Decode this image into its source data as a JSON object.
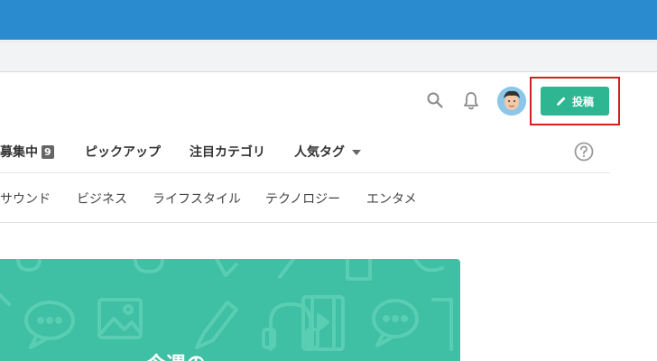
{
  "header": {
    "post_button_label": "投稿"
  },
  "nav": {
    "items": [
      {
        "label": "募集中",
        "badge": "9"
      },
      {
        "label": "ピックアップ"
      },
      {
        "label": "注目カテゴリ"
      },
      {
        "label": "人気タグ"
      }
    ]
  },
  "subnav": {
    "items": [
      "サウンド",
      "ビジネス",
      "ライフスタイル",
      "テクノロジー",
      "エンタメ"
    ]
  },
  "banner": {
    "title": "今週の"
  },
  "colors": {
    "top_band": "#2a8bcf",
    "post_button": "#2eb591",
    "highlight": "#d21f1f",
    "banner": "#3fbfa3"
  },
  "icons": [
    "search-icon",
    "bell-icon",
    "avatar",
    "pencil-icon",
    "chevron-down-icon",
    "help-icon"
  ]
}
